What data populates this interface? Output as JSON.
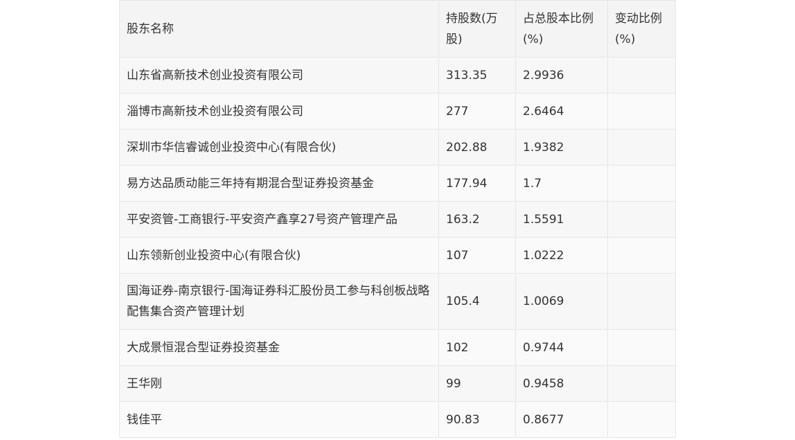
{
  "table": {
    "headers": [
      "股东名称",
      "持股数(万股)",
      "占总股本比例(%)",
      "变动比例(%)"
    ],
    "rows": [
      {
        "name": "山东省高新技术创业投资有限公司",
        "shares": "313.35",
        "ratio": "2.9936",
        "change": ""
      },
      {
        "name": "淄博市高新技术创业投资有限公司",
        "shares": "277",
        "ratio": "2.6464",
        "change": ""
      },
      {
        "name": "深圳市华信睿诚创业投资中心(有限合伙)",
        "shares": "202.88",
        "ratio": "1.9382",
        "change": ""
      },
      {
        "name": "易方达品质动能三年持有期混合型证券投资基金",
        "shares": "177.94",
        "ratio": "1.7",
        "change": ""
      },
      {
        "name": "平安资管-工商银行-平安资产鑫享27号资产管理产品",
        "shares": "163.2",
        "ratio": "1.5591",
        "change": ""
      },
      {
        "name": "山东领新创业投资中心(有限合伙)",
        "shares": "107",
        "ratio": "1.0222",
        "change": ""
      },
      {
        "name": "国海证券-南京银行-国海证券科汇股份员工参与科创板战略配售集合资产管理计划",
        "shares": "105.4",
        "ratio": "1.0069",
        "change": ""
      },
      {
        "name": "大成景恒混合型证券投资基金",
        "shares": "102",
        "ratio": "0.9744",
        "change": ""
      },
      {
        "name": "王华刚",
        "shares": "99",
        "ratio": "0.9458",
        "change": ""
      },
      {
        "name": "钱佳平",
        "shares": "90.83",
        "ratio": "0.8677",
        "change": ""
      }
    ]
  }
}
